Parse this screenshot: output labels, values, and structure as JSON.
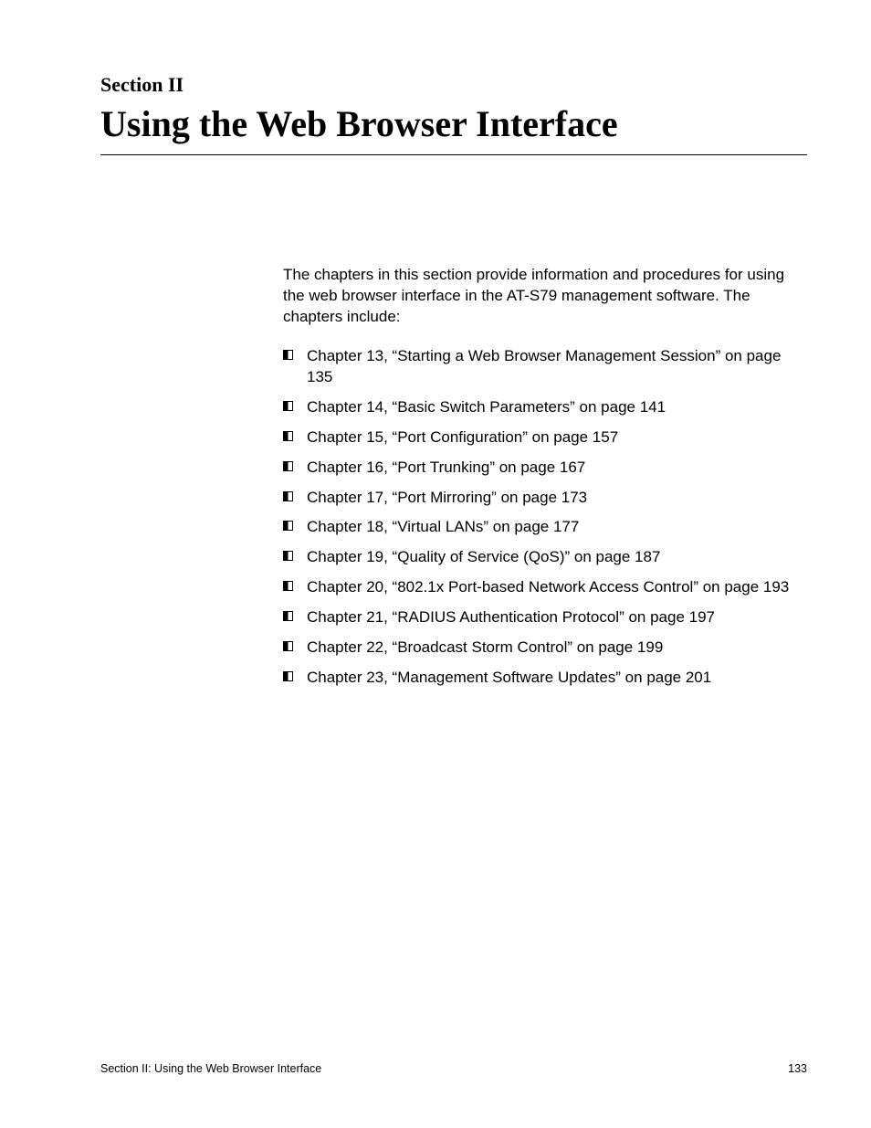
{
  "section_label": "Section II",
  "title": "Using the Web Browser Interface",
  "intro": "The chapters in this section provide information and procedures for using the web browser interface in the AT-S79 management software. The chapters include:",
  "chapters": [
    "Chapter 13, “Starting a Web Browser Management Session” on page 135",
    "Chapter 14, “Basic Switch Parameters” on page 141",
    "Chapter 15, “Port Configuration” on page 157",
    "Chapter 16, “Port Trunking” on page 167",
    "Chapter 17, “Port Mirroring” on page 173",
    "Chapter 18, “Virtual LANs” on page 177",
    "Chapter 19, “Quality of Service (QoS)” on page 187",
    "Chapter 20, “802.1x Port-based Network Access Control” on page 193",
    "Chapter 21, “RADIUS Authentication Protocol” on page 197",
    "Chapter 22, “Broadcast Storm Control” on page 199",
    "Chapter 23, “Management Software Updates” on page 201"
  ],
  "footer_left": "Section II: Using the Web Browser Interface",
  "footer_right": "133"
}
